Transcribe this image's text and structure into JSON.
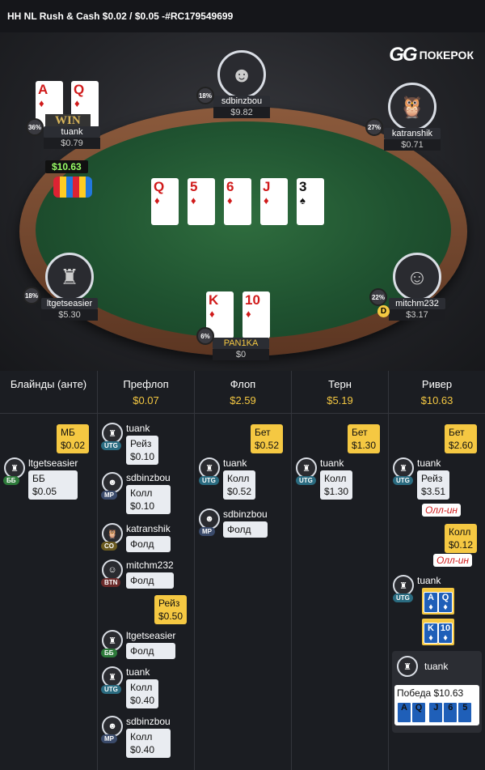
{
  "header": {
    "title": "HH NL Rush & Cash $0.02 / $0.05 -#RC179549699"
  },
  "logo": {
    "text": "ПОКЕРОК",
    "gg": "GG"
  },
  "players": {
    "top": {
      "name": "sdbinzbou",
      "stack": "$9.82",
      "pct": "18%"
    },
    "topleft": {
      "name": "tuank",
      "stack": "$0.79",
      "pct": "36%",
      "win": "WIN"
    },
    "topright": {
      "name": "katranshik",
      "stack": "$0.71",
      "pct": "27%"
    },
    "left": {
      "name": "ltgetseasier",
      "stack": "$5.30",
      "pct": "18%"
    },
    "right": {
      "name": "mitchm232",
      "stack": "$3.17",
      "pct": "22%",
      "dealer": "D"
    },
    "bottom": {
      "name": "PAN1KA",
      "stack": "$0",
      "pct": "6%"
    }
  },
  "pot": "$10.63",
  "hero_cards": [
    {
      "r": "A",
      "s": "♦"
    },
    {
      "r": "Q",
      "s": "♦"
    }
  ],
  "board": [
    {
      "r": "Q",
      "s": "♦"
    },
    {
      "r": "5",
      "s": "♦"
    },
    {
      "r": "6",
      "s": "♦"
    },
    {
      "r": "J",
      "s": "♦"
    },
    {
      "r": "3",
      "s": "♠"
    }
  ],
  "bottom_cards": [
    {
      "r": "K",
      "s": "♦"
    },
    {
      "r": "10",
      "s": "♦"
    }
  ],
  "columns": [
    {
      "label": "Блайнды (анте)",
      "amount": ""
    },
    {
      "label": "Префлоп",
      "amount": "$0.07"
    },
    {
      "label": "Флоп",
      "amount": "$2.59"
    },
    {
      "label": "Терн",
      "amount": "$5.19"
    },
    {
      "label": "Ривер",
      "amount": "$10.63"
    }
  ],
  "blinds": {
    "mb": "МБ\n$0.02",
    "player": "ltgetseasier",
    "pos": "ББ",
    "action": "ББ\n$0.05"
  },
  "preflop": [
    {
      "name": "tuank",
      "pos": "UTG",
      "action": "Рейз\n$0.10"
    },
    {
      "name": "sdbinzbou",
      "pos": "MP",
      "action": "Колл\n$0.10"
    },
    {
      "name": "katranshik",
      "pos": "CO",
      "action": "Фолд"
    },
    {
      "name": "mitchm232",
      "pos": "BTN",
      "action": "Фолд"
    },
    {
      "name": "ltgetseasier",
      "pos": "ББ",
      "action": "Фолд"
    },
    {
      "name": "tuank",
      "pos": "UTG",
      "action": "Колл\n$0.40"
    },
    {
      "name": "sdbinzbou",
      "pos": "MP",
      "action": "Колл\n$0.40"
    }
  ],
  "preflop_raise": "Рейз\n$0.50",
  "flop": {
    "bet": "Бет\n$0.52",
    "a1": {
      "name": "tuank",
      "pos": "UTG",
      "action": "Колл\n$0.52"
    },
    "a2": {
      "name": "sdbinzbou",
      "pos": "MP",
      "action": "Фолд"
    }
  },
  "turn": {
    "bet": "Бет\n$1.30",
    "a1": {
      "name": "tuank",
      "pos": "UTG",
      "action": "Колл\n$1.30"
    }
  },
  "river": {
    "bet": "Бет\n$2.60",
    "a1": {
      "name": "tuank",
      "pos": "UTG",
      "action": "Рейз\n$3.51"
    },
    "allin1": "Олл-ин",
    "call": "Колл\n$0.12",
    "allin2": "Олл-ин",
    "show": {
      "name": "tuank",
      "pos": "UTG"
    }
  },
  "winner": {
    "name": "tuank",
    "text": "Победа $10.63",
    "cards": [
      "A",
      "Q",
      "J",
      "6",
      "5"
    ]
  },
  "show_cards1": [
    "A",
    "Q"
  ],
  "show_cards2": [
    "K",
    "10"
  ],
  "colors": {
    "accent": "#f5c842",
    "felt": "#1f5230",
    "allin": "#d01a1a"
  }
}
